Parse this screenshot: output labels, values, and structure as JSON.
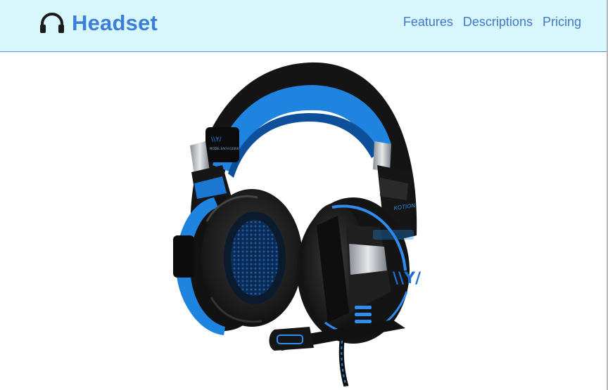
{
  "header": {
    "brand": {
      "title": "Headset",
      "icon": "headphones-icon"
    },
    "nav": [
      {
        "label": "Features"
      },
      {
        "label": "Descriptions"
      },
      {
        "label": "Pricing"
      }
    ]
  },
  "hero": {
    "image": "headset-product-image",
    "image_text": {
      "brand": "KOTION",
      "model": "MODEL EACH G2000"
    }
  },
  "colors": {
    "header_bg": "#d8f7fd",
    "brand": "#3e7edb",
    "nav_link": "#3f78c9",
    "accent_blue": "#1e84e0",
    "headset_black": "#151515"
  }
}
